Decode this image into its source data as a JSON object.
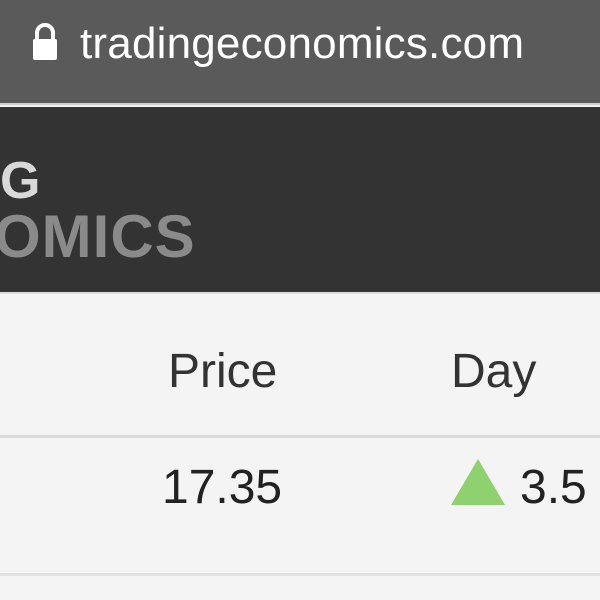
{
  "browser": {
    "url": "tradingeconomics.com",
    "lock_icon": "lock-icon"
  },
  "header": {
    "logo_line1": "G",
    "logo_line2": "OMICS"
  },
  "table": {
    "columns": [
      "Price",
      "Day"
    ],
    "rows": [
      {
        "price": "17.35",
        "day": "3.5",
        "direction_icon": "up-triangle-icon",
        "direction_color": "#8fd16e"
      }
    ]
  },
  "colors": {
    "urlbar_bg": "#5a5a5a",
    "header_bg": "#333333",
    "positive": "#8fd16e"
  }
}
